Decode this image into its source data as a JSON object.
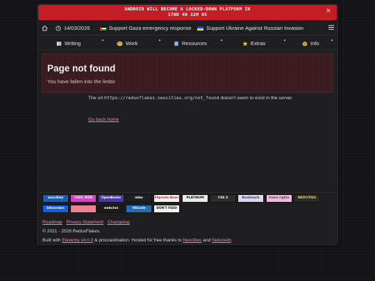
{
  "alert": {
    "line1": "ANDROID WILL BECOME A LOCKED-DOWN PLATFORM IN",
    "line2": "170D 4H 32M 0S",
    "close": "×"
  },
  "topbar": {
    "date": "14/03/2026",
    "gaza": "Support Gaza emergency response",
    "ukraine": "Support Ukraine Against Russian Invasion"
  },
  "nav": {
    "tabs": [
      {
        "label": "Writing",
        "icon": "book-icon"
      },
      {
        "label": "Work",
        "icon": "palette-icon"
      },
      {
        "label": "Resources",
        "icon": "notebook-icon"
      },
      {
        "label": "Extras",
        "icon": "star-icon"
      },
      {
        "label": "Info",
        "icon": "box-icon"
      }
    ]
  },
  "main": {
    "title": "Page not found",
    "subtitle": "You have fallen into the limbo",
    "msg_prefix": "The url ",
    "url": "https://reduxflakes.neocities.org/not_found",
    "msg_suffix": " doesn't seem to exist in the server.",
    "back": "Go back home"
  },
  "footer": {
    "badges": [
      {
        "text": "neocities",
        "bg": "#1f5fa8",
        "fg": "#ffffff"
      },
      {
        "text": "COOL WEB",
        "bg": "#d442c6",
        "fg": "#ffffff"
      },
      {
        "text": "OpenBooks",
        "bg": "#4a3a9e",
        "fg": "#ffffff"
      },
      {
        "text": "nkko",
        "bg": "#1e1e21",
        "fg": "#ffffff"
      },
      {
        "text": "Flipnote Now!",
        "bg": "#f2f2f2",
        "fg": "#c0262c"
      },
      {
        "text": "PLATINUM",
        "bg": "#ececec",
        "fg": "#111111"
      },
      {
        "text": "CSS 3",
        "bg": "#2c2c2c",
        "fg": "#ffffff"
      },
      {
        "text": "Bookmark",
        "bg": "#d8d8ee",
        "fg": "#3a3a70"
      },
      {
        "text": "trans rights",
        "bg": "#f5b8d8",
        "fg": "#1f4f7f"
      },
      {
        "text": "NEOCITIES",
        "bg": "#2a2a2a",
        "fg": "#ffd65a"
      },
      {
        "text": "bitwarden",
        "bg": "#175ddc",
        "fg": "#ffffff"
      },
      {
        "text": "",
        "bg": "#f08090",
        "fg": "#ffffff"
      },
      {
        "text": "webchni",
        "bg": "#1a1a1a",
        "fg": "#ffffff"
      },
      {
        "text": "VSCode",
        "bg": "#1f6fb8",
        "fg": "#ffffff"
      },
      {
        "text": "DON'T FEED",
        "bg": "#f2f2f2",
        "fg": "#111111"
      }
    ],
    "links": [
      "Roadmap",
      "Privacy Statement",
      "Changelog"
    ],
    "copyright": "© 2021 - 2026 ReduxFlakes.",
    "built_prefix": "Built with ",
    "eleventy": "Eleventy v4.0.0",
    "built_mid": " & procrastination. Hosted for free thanks to ",
    "neocities": "Neocities",
    "built_and": " and ",
    "nekoweb": "Nekoweb",
    "built_end": "."
  },
  "colors": {
    "accent": "#f08aa6",
    "alert": "#c41e24",
    "banner": "#3a1b20"
  }
}
